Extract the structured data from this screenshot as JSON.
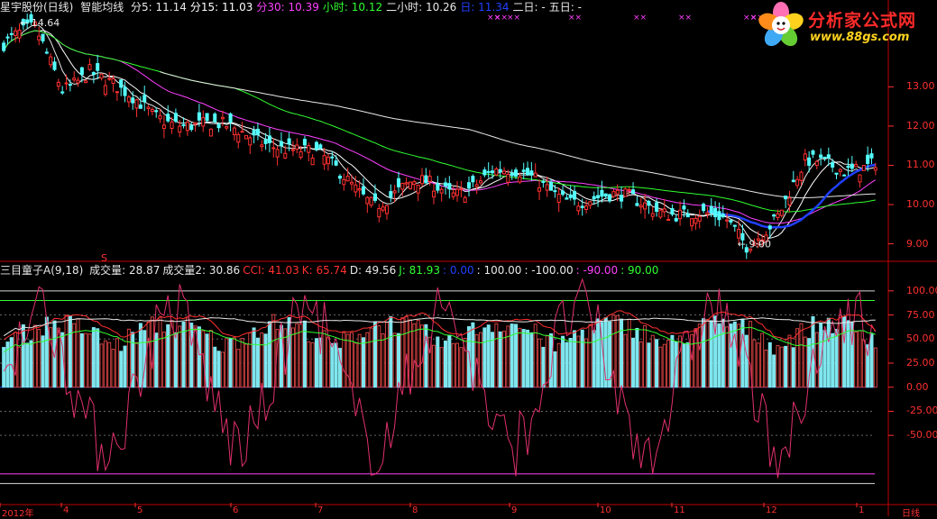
{
  "header": {
    "stock": "星宇股份(日线)",
    "indicator": "智能均线",
    "ma_labels": [
      {
        "text": "分5: 11.14",
        "color": "#e8e8e8"
      },
      {
        "text": "分15: 11.03",
        "color": "#ffffff"
      },
      {
        "text": "分30: 10.39",
        "color": "#ff40ff"
      },
      {
        "text": "小时: 10.12",
        "color": "#30ff30"
      },
      {
        "text": "二小时: 10.26",
        "color": "#e8e8e8"
      },
      {
        "text": "日: 11.34",
        "color": "#2040ff"
      },
      {
        "text": "二日: -",
        "color": "#e8e8e8"
      },
      {
        "text": "五日: -",
        "color": "#e8e8e8"
      }
    ]
  },
  "indicator_header": {
    "name": "三目童子A(9,18)",
    "values": [
      {
        "text": "成交量: 28.87",
        "color": "#e8e8e8"
      },
      {
        "text": "成交量2: 30.86",
        "color": "#e8e8e8"
      },
      {
        "text": "CCI: 41.03",
        "color": "#ff3030"
      },
      {
        "text": "K: 65.74",
        "color": "#ff3030"
      },
      {
        "text": "D: 49.56",
        "color": "#e8e8e8"
      },
      {
        "text": "J: 81.93",
        "color": "#30ff30"
      },
      {
        "text": ": 0.00",
        "color": "#2040ff"
      },
      {
        "text": ": 100.00",
        "color": "#e8e8e8"
      },
      {
        "text": ": -100.00",
        "color": "#e8e8e8"
      },
      {
        "text": ": -90.00",
        "color": "#ff40ff"
      },
      {
        "text": ": 90.00",
        "color": "#30ff30"
      }
    ]
  },
  "logo": {
    "title": "分析家公式网",
    "url": "www.88gs.com"
  },
  "annotations": {
    "high": "14.64",
    "low": "9.00",
    "marker": "S"
  },
  "chart_data": [
    {
      "type": "candlestick",
      "title": "星宇股份(日线)",
      "yticks": [
        13.0,
        12.0,
        11.0,
        10.0,
        9.0
      ],
      "ytick_labels": [
        "13.00",
        "12.00",
        "11.00",
        "10.00",
        "9.00"
      ],
      "ylim": [
        8.6,
        14.8
      ],
      "x_month_labels": [
        "2012年",
        "4",
        "5",
        "6",
        "7",
        "8",
        "9",
        "10",
        "11",
        "12",
        "1"
      ],
      "x_axis_unit": "日线",
      "keypoints": [
        {
          "t": 0,
          "v": 14.1
        },
        {
          "t": 8,
          "v": 14.4
        },
        {
          "t": 15,
          "v": 13.0
        },
        {
          "t": 22,
          "v": 13.5
        },
        {
          "t": 30,
          "v": 12.8
        },
        {
          "t": 38,
          "v": 12.3
        },
        {
          "t": 48,
          "v": 12.1
        },
        {
          "t": 60,
          "v": 11.8
        },
        {
          "t": 70,
          "v": 11.6
        },
        {
          "t": 80,
          "v": 11.2
        },
        {
          "t": 95,
          "v": 10.1
        },
        {
          "t": 105,
          "v": 10.5
        },
        {
          "t": 115,
          "v": 10.3
        },
        {
          "t": 125,
          "v": 10.9
        },
        {
          "t": 135,
          "v": 10.6
        },
        {
          "t": 145,
          "v": 10.2
        },
        {
          "t": 160,
          "v": 10.1
        },
        {
          "t": 175,
          "v": 9.8
        },
        {
          "t": 185,
          "v": 9.5
        },
        {
          "t": 190,
          "v": 9.0
        },
        {
          "t": 198,
          "v": 9.8
        },
        {
          "t": 205,
          "v": 11.0
        },
        {
          "t": 215,
          "v": 10.9
        },
        {
          "t": 223,
          "v": 11.2
        }
      ],
      "candle_count": 224,
      "series": [
        {
          "name": "分5",
          "color": "#e8e8e8"
        },
        {
          "name": "分15",
          "color": "#ffffff"
        },
        {
          "name": "分30",
          "color": "#ff40ff"
        },
        {
          "name": "小时",
          "color": "#30ff30"
        },
        {
          "name": "二小时",
          "color": "#e8e8e8"
        },
        {
          "name": "日",
          "color": "#2040ff",
          "partial_from": 180
        }
      ]
    },
    {
      "type": "bar",
      "title": "三目童子A(9,18)",
      "yticks": [
        100,
        75,
        50,
        25,
        0,
        -25,
        -50
      ],
      "ytick_labels": [
        "100.00",
        "75.00",
        "50.00",
        "25.00",
        "0.00",
        "-25.00",
        "-50.00"
      ],
      "ylim": [
        -120,
        112
      ],
      "hlines": [
        {
          "value": 100,
          "color": "#d8d8d8"
        },
        {
          "value": 90,
          "color": "#30ff30"
        },
        {
          "value": 0,
          "color": "#2040ff"
        },
        {
          "value": -90,
          "color": "#ff40ff"
        },
        {
          "value": -100,
          "color": "#d8d8d8"
        }
      ],
      "series": [
        {
          "name": "成交量",
          "color": "#7fe6ee"
        },
        {
          "name": "CCI",
          "color": "#e0306a"
        },
        {
          "name": "K",
          "color": "#ff3030"
        },
        {
          "name": "D",
          "color": "#e8e8e8"
        },
        {
          "name": "J",
          "color": "#30ff30"
        }
      ]
    }
  ]
}
